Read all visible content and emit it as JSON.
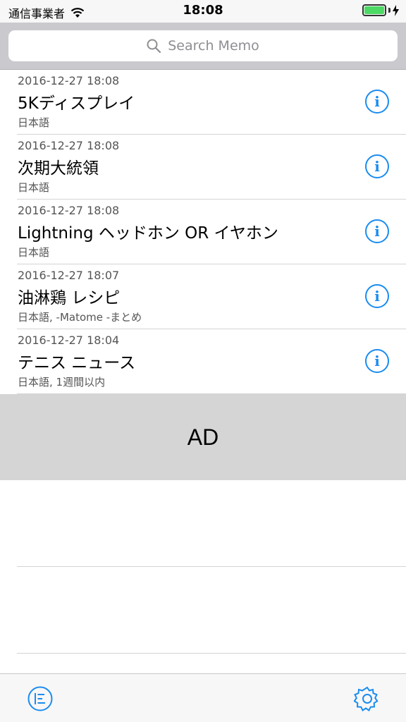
{
  "status_bar": {
    "carrier": "通信事業者",
    "time": "18:08",
    "battery_level": 1.0
  },
  "search": {
    "placeholder": "Search Memo"
  },
  "memos": [
    {
      "date": "2016-12-27 18:08",
      "title": "5Kディスプレイ",
      "tags": "日本語"
    },
    {
      "date": "2016-12-27 18:08",
      "title": "次期大統領",
      "tags": "日本語"
    },
    {
      "date": "2016-12-27 18:08",
      "title": "Lightning ヘッドホン OR イヤホン",
      "tags": "日本語"
    },
    {
      "date": "2016-12-27 18:07",
      "title": "油淋鶏 レシピ",
      "tags": "日本語, -Matome -まとめ"
    },
    {
      "date": "2016-12-27 18:04",
      "title": "テニス ニュース",
      "tags": "日本語, 1週間以内"
    }
  ],
  "ad": {
    "label": "AD"
  },
  "toolbar": {
    "left_icon": "sort-list-icon",
    "right_icon": "gear-icon"
  },
  "colors": {
    "accent": "#1a8cf0",
    "ad_background": "#d5d5d5",
    "search_background": "#c9c9ce"
  }
}
